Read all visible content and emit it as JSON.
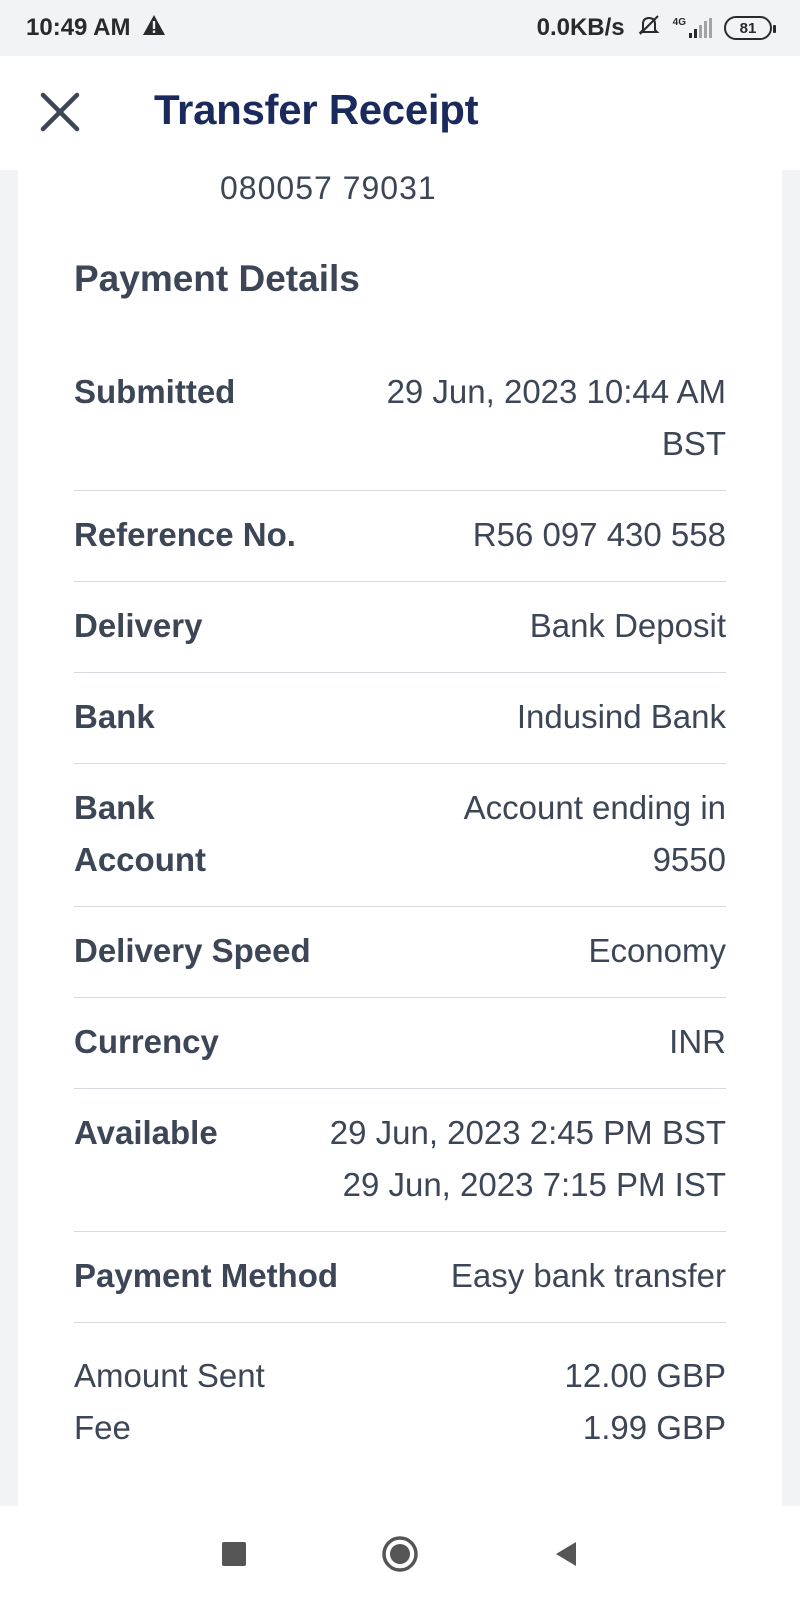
{
  "status_bar": {
    "time": "10:49 AM",
    "network_speed": "0.0KB/s",
    "network_type": "4G",
    "battery": "81",
    "icons": [
      "warning-icon",
      "mute-icon",
      "signal-icon",
      "battery-icon"
    ]
  },
  "header": {
    "title": "Transfer Receipt",
    "close_icon": "close-icon"
  },
  "account_number": "080057 79031",
  "payment_details": {
    "title": "Payment Details",
    "rows": [
      {
        "label": "Submitted",
        "value_line1": "29 Jun, 2023 10:44 AM",
        "value_line2": "BST"
      },
      {
        "label": "Reference No.",
        "value": "R56 097 430 558"
      },
      {
        "label": "Delivery",
        "value": "Bank Deposit"
      },
      {
        "label": "Bank",
        "value": "Indusind Bank"
      },
      {
        "label_line1": "Bank",
        "label_line2": "Account",
        "value_line1": "Account ending in",
        "value_line2": "9550"
      },
      {
        "label": "Delivery Speed",
        "value": "Economy"
      },
      {
        "label": "Currency",
        "value": "INR"
      },
      {
        "label": "Available",
        "value_line1": "29 Jun, 2023 2:45 PM BST",
        "value_line2": "29 Jun, 2023 7:15 PM IST"
      },
      {
        "label": "Payment Method",
        "value": "Easy bank transfer"
      }
    ]
  },
  "summary": {
    "amount_sent_label": "Amount Sent",
    "amount_sent_value": "12.00 GBP",
    "fee_label": "Fee",
    "fee_value": "1.99 GBP"
  },
  "nav": {
    "icons": [
      "recents-square-icon",
      "home-circle-icon",
      "back-triangle-icon"
    ]
  },
  "colors": {
    "title": "#1b2a5c",
    "text": "#3d4656",
    "divider": "#d5dae1",
    "background": "#f2f3f7"
  }
}
